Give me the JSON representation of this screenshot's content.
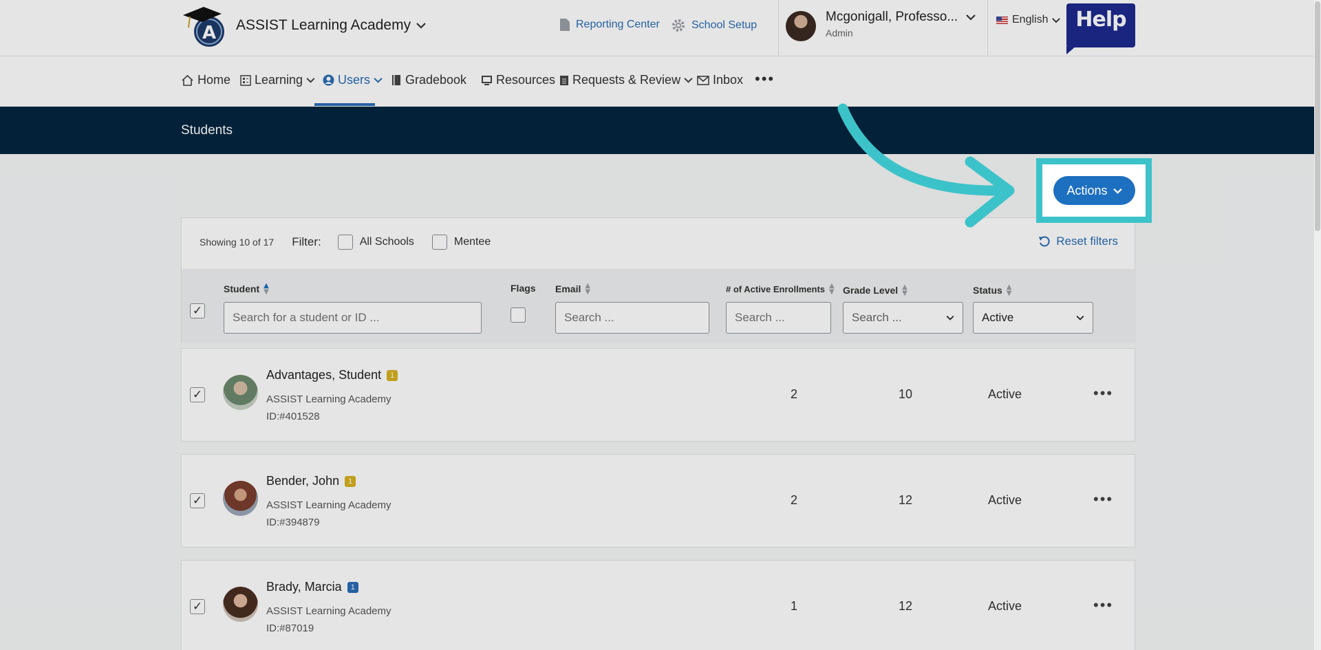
{
  "header": {
    "school_name": "ASSIST Learning Academy",
    "reporting_center": "Reporting Center",
    "school_setup": "School Setup",
    "user_name": "Mcgonigall, Professo...",
    "user_role": "Admin",
    "language": "English",
    "help_label": "Help"
  },
  "nav": {
    "items": [
      {
        "label": "Home",
        "icon": "home-icon"
      },
      {
        "label": "Learning",
        "icon": "learning-icon"
      },
      {
        "label": "Users",
        "icon": "user-circle-icon",
        "active": true
      },
      {
        "label": "Gradebook",
        "icon": "book-icon"
      },
      {
        "label": "Resources",
        "icon": "monitor-icon"
      },
      {
        "label": "Requests & Review",
        "icon": "clipboard-icon"
      },
      {
        "label": "Inbox",
        "icon": "mail-icon"
      }
    ],
    "more": "•••"
  },
  "page": {
    "title": "Students",
    "actions_label": "Actions"
  },
  "filters": {
    "showing": "Showing 10 of 17",
    "filter_label": "Filter:",
    "all_schools": "All Schools",
    "mentee": "Mentee",
    "reset": "Reset filters"
  },
  "columns": {
    "student": "Student",
    "flags": "Flags",
    "email": "Email",
    "enrollments": "# of Active Enrollments",
    "grade": "Grade Level",
    "status": "Status",
    "student_placeholder": "Search for a student or ID ...",
    "email_placeholder": "Search ...",
    "enrollments_placeholder": "Search ...",
    "grade_placeholder": "Search ...",
    "status_value": "Active"
  },
  "rows": [
    {
      "name": "Advantages, Student",
      "flag": "1",
      "flag_color": "#d6b21f",
      "school": "ASSIST Learning Academy",
      "id": "ID:#401528",
      "enrollments": "2",
      "grade": "10",
      "status": "Active"
    },
    {
      "name": "Bender, John",
      "flag": "1",
      "flag_color": "#d6b21f",
      "school": "ASSIST Learning Academy",
      "id": "ID:#394879",
      "enrollments": "2",
      "grade": "12",
      "status": "Active"
    },
    {
      "name": "Brady, Marcia",
      "flag": "1",
      "flag_color": "#2a6db5",
      "school": "ASSIST Learning Academy",
      "id": "ID:#87019",
      "enrollments": "1",
      "grade": "12",
      "status": "Active"
    }
  ],
  "colors": {
    "accent": "#2a6db5",
    "banner": "#04253f",
    "highlight": "#3cc3c9",
    "action_button": "#1d6fc0"
  }
}
